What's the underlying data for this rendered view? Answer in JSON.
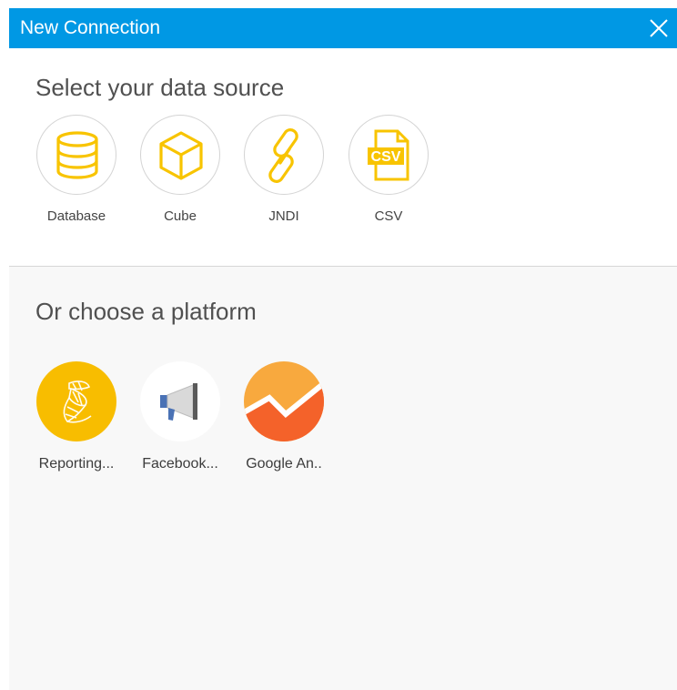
{
  "dialog": {
    "title": "New Connection",
    "accent_color": "#0098e4",
    "close_icon": "close-icon"
  },
  "data_source": {
    "heading": "Select your data source",
    "icon_color": "#f8c400",
    "items": [
      {
        "label": "Database",
        "icon": "database-icon"
      },
      {
        "label": "Cube",
        "icon": "cube-icon"
      },
      {
        "label": "JNDI",
        "icon": "chain-link-icon"
      },
      {
        "label": "CSV",
        "icon": "csv-file-icon",
        "icon_text": "CSV"
      }
    ]
  },
  "platform": {
    "heading": "Or choose a platform",
    "items": [
      {
        "label": "Reporting...",
        "icon": "sql-server-reporting-icon",
        "color": "#f8bd00"
      },
      {
        "label": "Facebook...",
        "icon": "megaphone-icon",
        "color": "#4a72b5"
      },
      {
        "label": "Google An..",
        "icon": "google-analytics-icon",
        "color": "#f4622a"
      }
    ]
  }
}
